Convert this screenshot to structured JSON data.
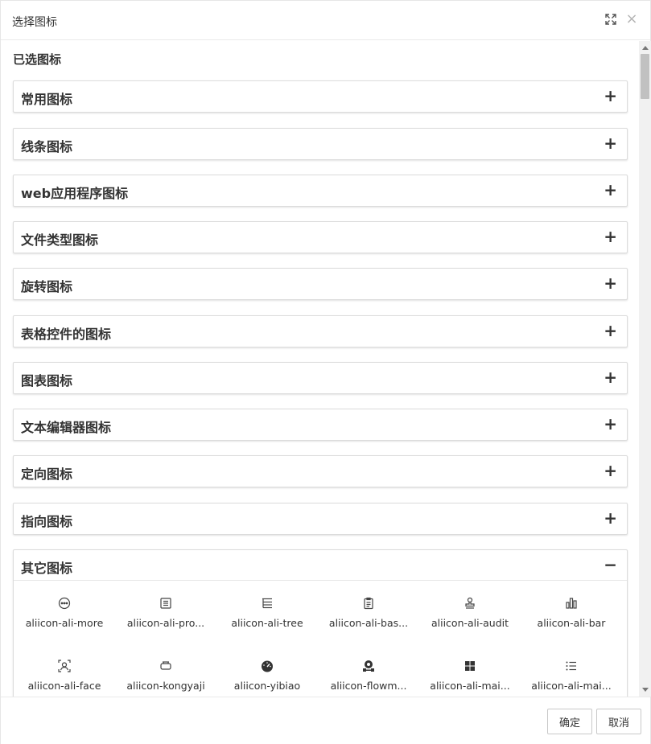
{
  "dialog": {
    "title": "选择图标",
    "maximize_icon": "maximize-icon",
    "close_icon": "close-icon",
    "close_glyph": "×"
  },
  "selected_label": "已选图标",
  "categories": [
    {
      "label": "常用图标",
      "toggle": "+"
    },
    {
      "label": "线条图标",
      "toggle": "+"
    },
    {
      "label": "web应用程序图标",
      "toggle": "+"
    },
    {
      "label": "文件类型图标",
      "toggle": "+"
    },
    {
      "label": "旋转图标",
      "toggle": "+"
    },
    {
      "label": "表格控件的图标",
      "toggle": "+"
    },
    {
      "label": "图表图标",
      "toggle": "+"
    },
    {
      "label": "文本编辑器图标",
      "toggle": "+"
    },
    {
      "label": "定向图标",
      "toggle": "+"
    },
    {
      "label": "指向图标",
      "toggle": "+"
    },
    {
      "label": "其它图标",
      "toggle": "−"
    }
  ],
  "other_icons": [
    {
      "label": "aliicon-ali-more",
      "icon": "more-circle-icon"
    },
    {
      "label": "aliicon-ali-pro...",
      "icon": "project-list-icon"
    },
    {
      "label": "aliicon-ali-tree",
      "icon": "tree-list-icon"
    },
    {
      "label": "aliicon-ali-bas...",
      "icon": "clipboard-icon"
    },
    {
      "label": "aliicon-ali-audit",
      "icon": "audit-stamp-icon"
    },
    {
      "label": "aliicon-ali-bar",
      "icon": "bar-chart-icon"
    },
    {
      "label": "aliicon-ali-face",
      "icon": "face-scan-icon"
    },
    {
      "label": "aliicon-kongyaji",
      "icon": "air-compressor-icon"
    },
    {
      "label": "aliicon-yibiao",
      "icon": "gauge-icon"
    },
    {
      "label": "aliicon-flowm...",
      "icon": "flowmeter-icon"
    },
    {
      "label": "aliicon-ali-mai...",
      "icon": "grid-squares-icon"
    },
    {
      "label": "aliicon-ali-mai...",
      "icon": "bullet-list-icon"
    }
  ],
  "footer": {
    "ok_label": "确定",
    "cancel_label": "取消"
  },
  "colors": {
    "border": "#dcdcdc",
    "text": "#333333",
    "scroll_thumb": "#c1c1c1"
  }
}
